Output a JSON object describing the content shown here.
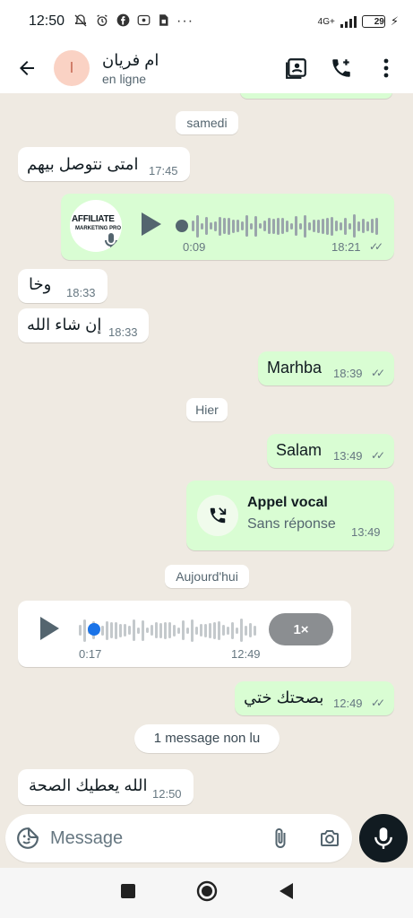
{
  "status_bar": {
    "time": "12:50",
    "network": "4G+",
    "battery": "29"
  },
  "header": {
    "contact_initial": "ا",
    "contact_name": "ام فريان",
    "contact_status": "en ligne"
  },
  "messages": {
    "date_samedi": "samedi",
    "m1_text": "امتى نتوصل بيهم",
    "m1_time": "17:45",
    "voice1_thumb_line1": "AFFILIATE",
    "voice1_thumb_line2": "MARKETING PRO",
    "voice1_duration": "0:09",
    "voice1_time": "18:21",
    "m2_text": "وخا",
    "m2_time": "18:33",
    "m3_text": "إن شاء الله",
    "m3_time": "18:33",
    "m4_text": "Marhba",
    "m4_time": "18:39",
    "date_hier": "Hier",
    "m5_text": "Salam",
    "m5_time": "13:49",
    "call_title": "Appel vocal",
    "call_subtitle": "Sans réponse",
    "call_time": "13:49",
    "date_today": "Aujourd'hui",
    "voice2_duration": "0:17",
    "voice2_time": "12:49",
    "voice2_speed": "1×",
    "m6_text": "بصحتك ختي",
    "m6_time": "12:49",
    "unread": "1 message non lu",
    "m7_text": "الله يعطيك الصحة",
    "m7_time": "12:50"
  },
  "composer": {
    "placeholder": "Message"
  }
}
